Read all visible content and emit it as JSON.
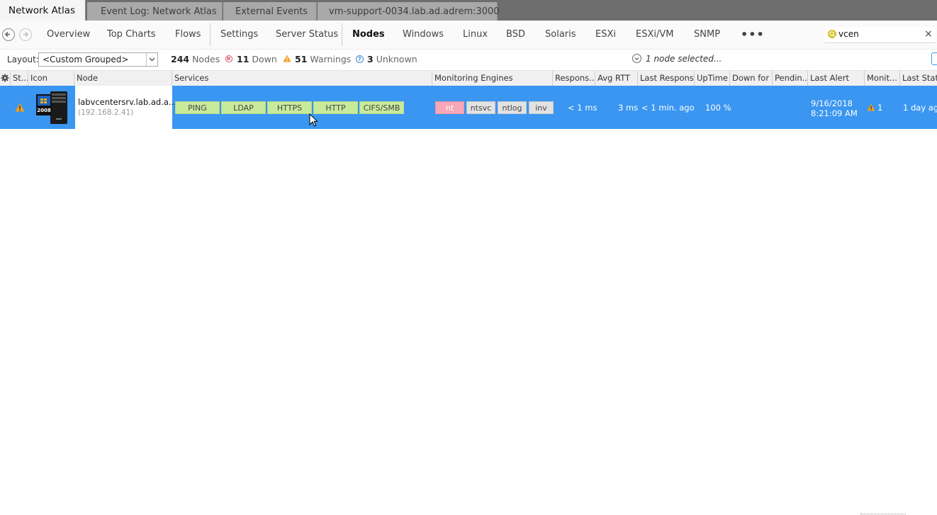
{
  "tabs": [
    {
      "label": "Network Atlas",
      "active": true
    },
    {
      "label": "Event Log: Network Atlas",
      "active": false
    },
    {
      "label": "External Events",
      "active": false
    },
    {
      "label": "vm-support-0034.lab.ad.adrem:3000",
      "active": false
    }
  ],
  "nav": {
    "items": [
      "Overview",
      "Top Charts",
      "Flows",
      "Settings",
      "Server Status",
      "Nodes",
      "Windows",
      "Linux",
      "BSD",
      "Solaris",
      "ESXi",
      "ESXi/VM",
      "SNMP"
    ],
    "active": "Nodes",
    "more_icon": "ellipsis-icon",
    "back_icon": "back-arrow-icon",
    "forward_icon": "forward-arrow-icon"
  },
  "search": {
    "value": "vcen",
    "clear": "×",
    "icon": "search-icon"
  },
  "toolbar": {
    "layout_label": "Layout:",
    "layout_value": "<Custom Grouped>",
    "nodes_count": "244",
    "nodes_label": "Nodes",
    "down_count": "11",
    "down_label": "Down",
    "warnings_count": "51",
    "warnings_label": "Warnings",
    "unknown_count": "3",
    "unknown_label": "Unknown",
    "selection_text": "1 node selected..."
  },
  "columns": [
    "St...",
    "Icon",
    "Node",
    "Services",
    "Monitoring Engines",
    "Respons...",
    "Avg RTT",
    "Last Response",
    "UpTime",
    "Down for",
    "Pendin...",
    "Last Alert",
    "Monit...",
    "Last Status"
  ],
  "row": {
    "status_icon": "warning-icon",
    "icon_badge": "2008",
    "node_name": "labvcentersrv.lab.ad.a...",
    "node_ip": "(192.168.2.41)",
    "services": [
      "PING",
      "LDAP",
      "HTTPS",
      "HTTP",
      "CIFS/SMB"
    ],
    "engines": [
      {
        "label": "nt",
        "state": "bad"
      },
      {
        "label": "ntsvc",
        "state": "ok"
      },
      {
        "label": "ntlog",
        "state": "ok"
      },
      {
        "label": "inv",
        "state": "ok"
      }
    ],
    "response": "< 1 ms",
    "avg_rtt": "3 ms",
    "last_response": "< 1 min. ago",
    "uptime": "100 %",
    "last_alert_date": "9/16/2018",
    "last_alert_time": "8:21:09 AM",
    "monit_count": "1",
    "last_status": "1 day ago"
  },
  "colors": {
    "selected_row": "#3a96f0",
    "service_ok": "#c8eb9b",
    "engine_bad": "#f7a8b8",
    "warning": "#f0a020"
  }
}
